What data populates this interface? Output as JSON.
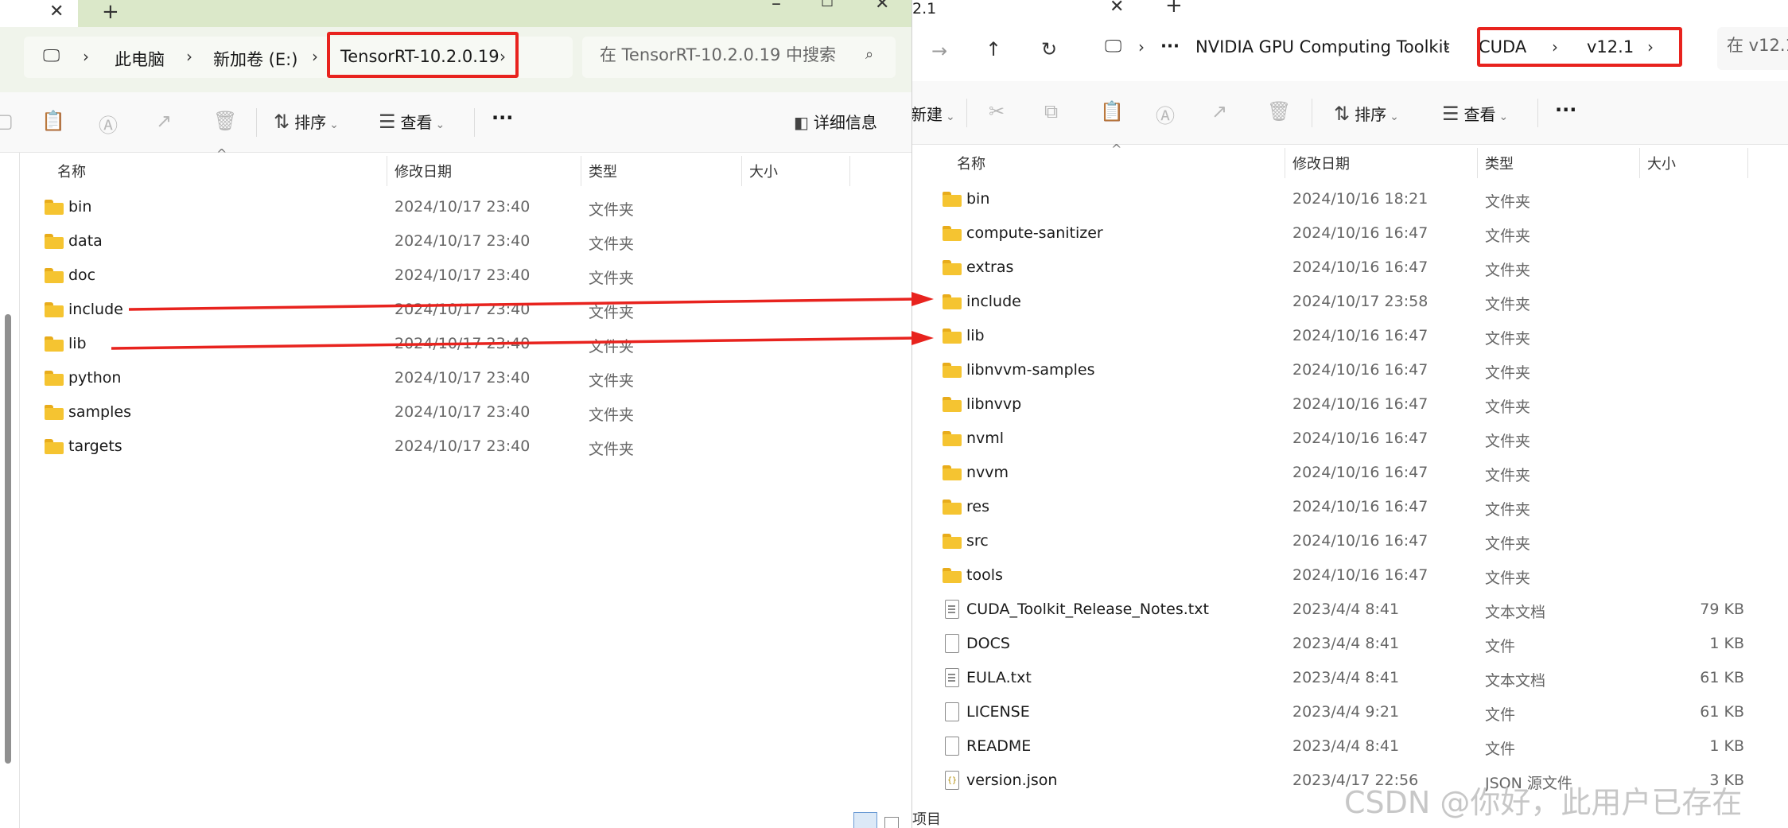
{
  "left": {
    "breadcrumb": [
      "此电脑",
      "新加卷 (E:)",
      "TensorRT-10.2.0.19"
    ],
    "search_placeholder": "在 TensorRT-10.2.0.19 中搜索",
    "toolbar": {
      "sort": "排序",
      "view": "查看",
      "more": "···",
      "details": "详细信息"
    },
    "columns": {
      "name": "名称",
      "date": "修改日期",
      "type": "类型",
      "size": "大小"
    },
    "rows": [
      {
        "name": "bin",
        "date": "2024/10/17 23:40",
        "type": "文件夹"
      },
      {
        "name": "data",
        "date": "2024/10/17 23:40",
        "type": "文件夹"
      },
      {
        "name": "doc",
        "date": "2024/10/17 23:40",
        "type": "文件夹"
      },
      {
        "name": "include",
        "date": "2024/10/17 23:40",
        "type": "文件夹"
      },
      {
        "name": "lib",
        "date": "2024/10/17 23:40",
        "type": "文件夹"
      },
      {
        "name": "python",
        "date": "2024/10/17 23:40",
        "type": "文件夹"
      },
      {
        "name": "samples",
        "date": "2024/10/17 23:40",
        "type": "文件夹"
      },
      {
        "name": "targets",
        "date": "2024/10/17 23:40",
        "type": "文件夹"
      }
    ]
  },
  "right": {
    "tab_title_fragment": "2.1",
    "breadcrumb": [
      "···",
      "NVIDIA GPU Computing Toolkit",
      "CUDA",
      "v12.1"
    ],
    "search_placeholder": "在 v12.1",
    "toolbar": {
      "new_fragment": "新建",
      "sort": "排序",
      "view": "查看",
      "more": "···"
    },
    "columns": {
      "name": "名称",
      "date": "修改日期",
      "type": "类型",
      "size": "大小"
    },
    "rows": [
      {
        "name": "bin",
        "date": "2024/10/16 18:21",
        "type": "文件夹",
        "size": "",
        "kind": "folder"
      },
      {
        "name": "compute-sanitizer",
        "date": "2024/10/16 16:47",
        "type": "文件夹",
        "size": "",
        "kind": "folder"
      },
      {
        "name": "extras",
        "date": "2024/10/16 16:47",
        "type": "文件夹",
        "size": "",
        "kind": "folder"
      },
      {
        "name": "include",
        "date": "2024/10/17 23:58",
        "type": "文件夹",
        "size": "",
        "kind": "folder"
      },
      {
        "name": "lib",
        "date": "2024/10/16 16:47",
        "type": "文件夹",
        "size": "",
        "kind": "folder"
      },
      {
        "name": "libnvvm-samples",
        "date": "2024/10/16 16:47",
        "type": "文件夹",
        "size": "",
        "kind": "folder"
      },
      {
        "name": "libnvvp",
        "date": "2024/10/16 16:47",
        "type": "文件夹",
        "size": "",
        "kind": "folder"
      },
      {
        "name": "nvml",
        "date": "2024/10/16 16:47",
        "type": "文件夹",
        "size": "",
        "kind": "folder"
      },
      {
        "name": "nvvm",
        "date": "2024/10/16 16:47",
        "type": "文件夹",
        "size": "",
        "kind": "folder"
      },
      {
        "name": "res",
        "date": "2024/10/16 16:47",
        "type": "文件夹",
        "size": "",
        "kind": "folder"
      },
      {
        "name": "src",
        "date": "2024/10/16 16:47",
        "type": "文件夹",
        "size": "",
        "kind": "folder"
      },
      {
        "name": "tools",
        "date": "2024/10/16 16:47",
        "type": "文件夹",
        "size": "",
        "kind": "folder"
      },
      {
        "name": "CUDA_Toolkit_Release_Notes.txt",
        "date": "2023/4/4 8:41",
        "type": "文本文档",
        "size": "79 KB",
        "kind": "txt"
      },
      {
        "name": "DOCS",
        "date": "2023/4/4 8:41",
        "type": "文件",
        "size": "1 KB",
        "kind": "file"
      },
      {
        "name": "EULA.txt",
        "date": "2023/4/4 8:41",
        "type": "文本文档",
        "size": "61 KB",
        "kind": "txt"
      },
      {
        "name": "LICENSE",
        "date": "2023/4/4 9:21",
        "type": "文件",
        "size": "61 KB",
        "kind": "file"
      },
      {
        "name": "README",
        "date": "2023/4/4 8:41",
        "type": "文件",
        "size": "1 KB",
        "kind": "file"
      },
      {
        "name": "version.json",
        "date": "2023/4/17 22:56",
        "type": "JSON 源文件",
        "size": "3 KB",
        "kind": "json"
      }
    ],
    "status_fragment": "项目"
  },
  "watermark": "CSDN @你好，此用户已存在",
  "colors": {
    "highlight": "#e8231e",
    "folder": "#f5c431",
    "left_tabbar": "#dbe8c9"
  }
}
